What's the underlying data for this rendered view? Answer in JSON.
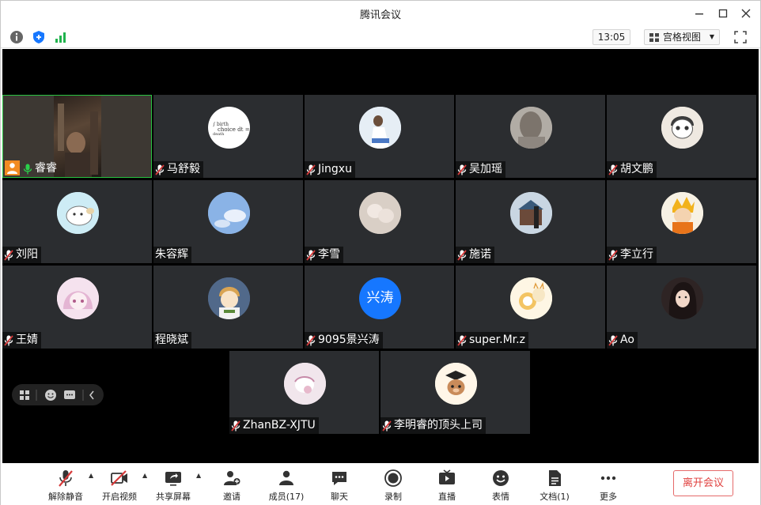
{
  "window": {
    "title": "腾讯会议",
    "minimize_icon": "minimize-icon",
    "maximize_icon": "maximize-icon",
    "close_icon": "close-icon"
  },
  "status": {
    "clock": "13:05",
    "view_mode": "宫格视图",
    "colors": {
      "shield": "#1677ff",
      "signal": "#21b34d"
    }
  },
  "participants": [
    {
      "name": "睿睿",
      "muted": false,
      "video_on": true,
      "host": true
    },
    {
      "name": "马舒毅",
      "muted": true,
      "avatar_bg": "#ffffff"
    },
    {
      "name": "Jingxu",
      "muted": true,
      "avatar_bg": "#dbe7f3"
    },
    {
      "name": "吴加瑶",
      "muted": true,
      "avatar_bg": "#a39e97"
    },
    {
      "name": "胡文鹏",
      "muted": true,
      "avatar_bg": "#ece6de"
    },
    {
      "name": "刘阳",
      "muted": true,
      "avatar_bg": "#c8eaf4"
    },
    {
      "name": "朱容辉",
      "muted": false,
      "avatar_bg": "#8fb7e8"
    },
    {
      "name": "李雪",
      "muted": true,
      "avatar_bg": "#d8cdc4"
    },
    {
      "name": "施诺",
      "muted": true,
      "avatar_bg": "#b7c8d8"
    },
    {
      "name": "李立行",
      "muted": true,
      "avatar_bg": "#f5efe2"
    },
    {
      "name": "王婧",
      "muted": true,
      "avatar_bg": "#f2dbe9"
    },
    {
      "name": "程晓斌",
      "muted": false,
      "avatar_bg": "#4f6a8e"
    },
    {
      "name": "9095景兴涛",
      "muted": true,
      "avatar_bg": "#1677ff",
      "avatar_text": "兴涛"
    },
    {
      "name": "super.Mr.z",
      "muted": true,
      "avatar_bg": "#fdf2d8"
    },
    {
      "name": "Ao",
      "muted": true,
      "avatar_bg": "#3b2c2c"
    },
    {
      "name": "ZhanBZ-XJTU",
      "muted": true,
      "avatar_bg": "#efe3e9"
    },
    {
      "name": "李明睿的顶头上司",
      "muted": true,
      "avatar_bg": "#fff2dc"
    }
  ],
  "toolbar": {
    "unmute": "解除静音",
    "start_video": "开启视频",
    "share_screen": "共享屏幕",
    "invite": "邀请",
    "members": "成员(17)",
    "chat": "聊天",
    "record": "录制",
    "live": "直播",
    "reactions": "表情",
    "docs": "文档(1)",
    "more": "更多",
    "leave": "离开会议",
    "colors": {
      "leave": "#e0413f",
      "muted_icon": "#d63a3a"
    }
  }
}
